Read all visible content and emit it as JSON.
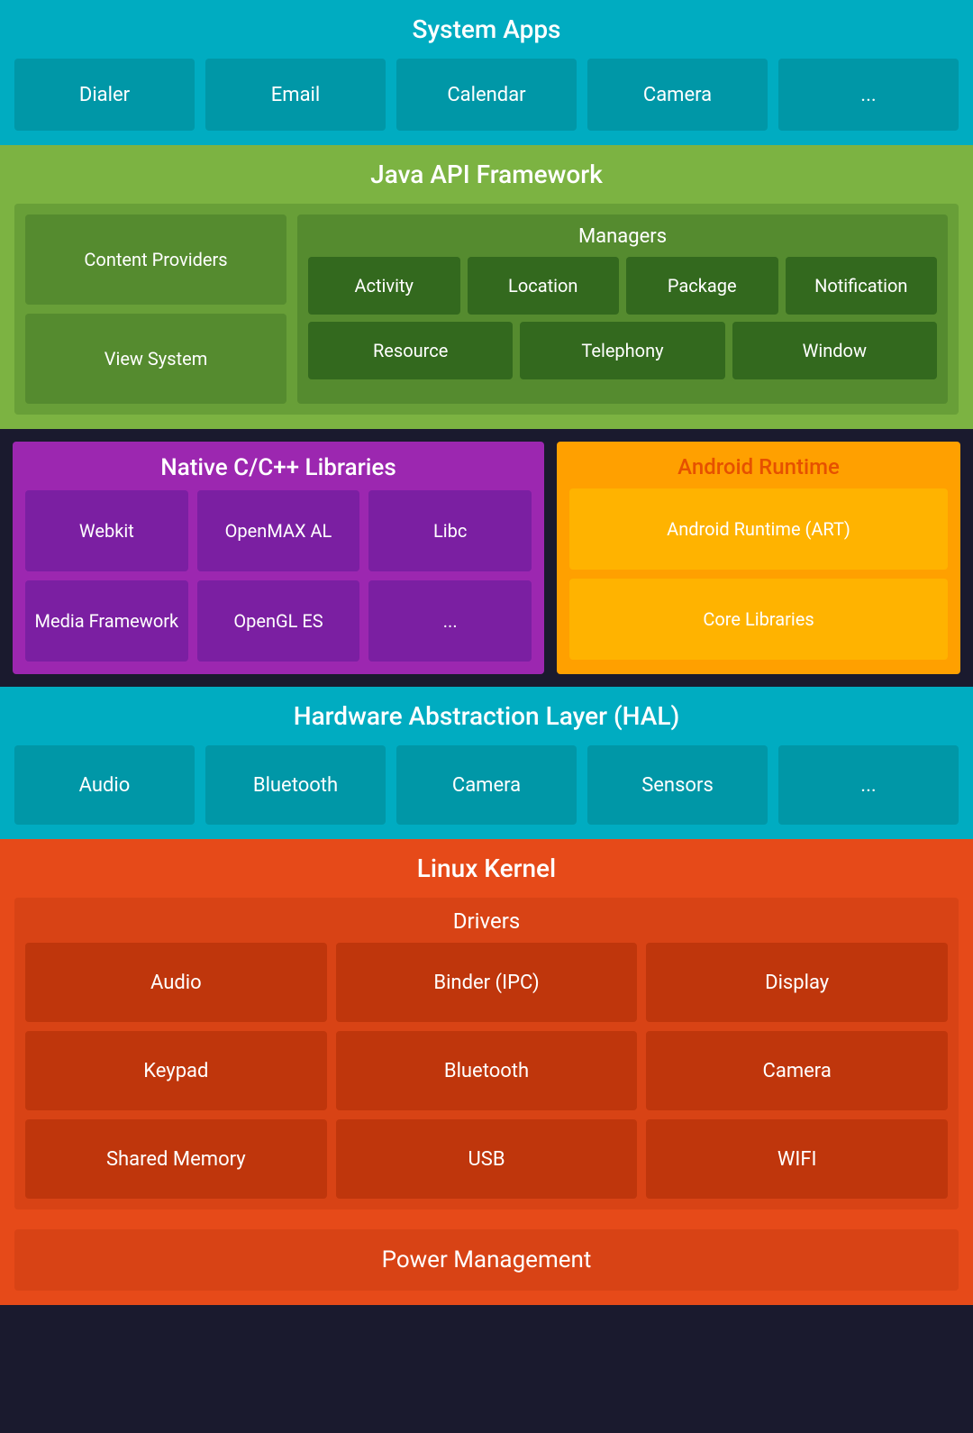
{
  "system_apps": {
    "title": "System Apps",
    "cards": [
      "Dialer",
      "Email",
      "Calendar",
      "Camera",
      "..."
    ]
  },
  "java_api": {
    "title": "Java API Framework",
    "content_providers": "Content Providers",
    "view_system": "View System",
    "managers_title": "Managers",
    "managers_row1": [
      "Activity",
      "Location",
      "Package",
      "Notification"
    ],
    "managers_row2": [
      "Resource",
      "Telephony",
      "Window"
    ]
  },
  "native_libs": {
    "title": "Native C/C++ Libraries",
    "row1": [
      "Webkit",
      "OpenMAX AL",
      "Libc"
    ],
    "row2": [
      "Media Framework",
      "OpenGL ES",
      "..."
    ]
  },
  "android_runtime": {
    "title": "Android Runtime",
    "card1": "Android Runtime (ART)",
    "card2": "Core Libraries"
  },
  "hal": {
    "title": "Hardware Abstraction Layer (HAL)",
    "cards": [
      "Audio",
      "Bluetooth",
      "Camera",
      "Sensors",
      "..."
    ]
  },
  "linux_kernel": {
    "title": "Linux Kernel",
    "drivers_title": "Drivers",
    "row1": [
      "Audio",
      "Binder (IPC)",
      "Display"
    ],
    "row2": [
      "Keypad",
      "Bluetooth",
      "Camera"
    ],
    "row3": [
      "Shared Memory",
      "USB",
      "WIFI"
    ],
    "power_management": "Power Management"
  }
}
